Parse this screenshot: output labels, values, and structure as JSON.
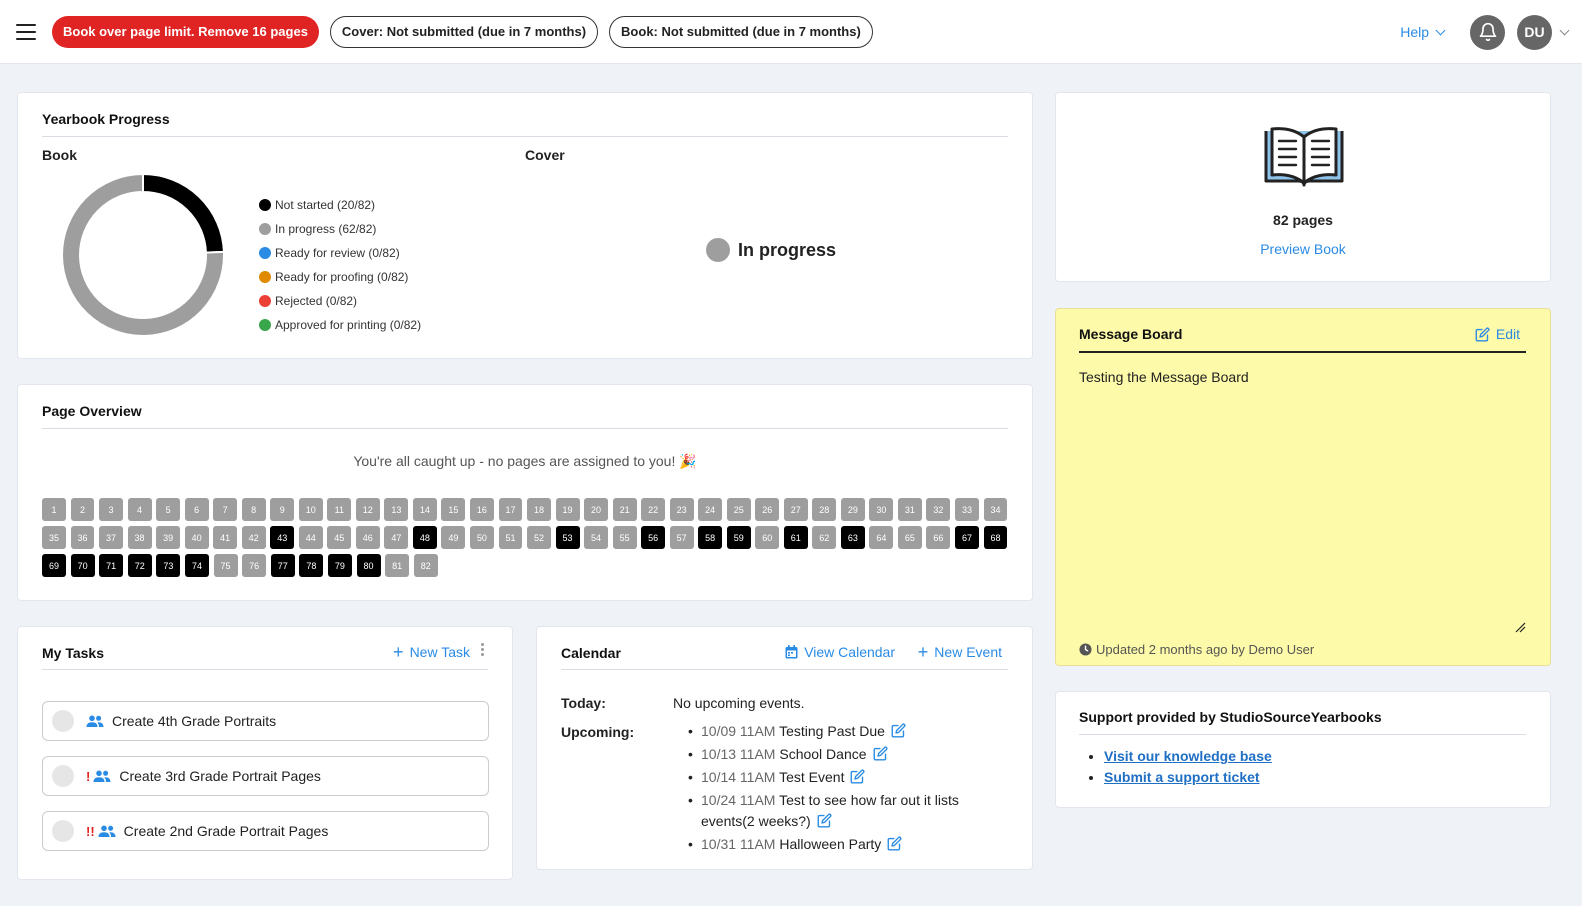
{
  "topbar": {
    "alerts": [
      {
        "label": "Book over page limit. Remove 16 pages",
        "style": "red"
      },
      {
        "label": "Cover: Not submitted (due in 7 months)",
        "style": "outline"
      },
      {
        "label": "Book: Not submitted (due in 7 months)",
        "style": "outline"
      }
    ],
    "help_label": "Help",
    "user_initials": "DU"
  },
  "progress": {
    "title": "Yearbook Progress",
    "book_label": "Book",
    "cover_label": "Cover",
    "cover_status": "In progress",
    "legend": [
      {
        "label": "Not started (20/82)",
        "color": "#000000",
        "count": 20
      },
      {
        "label": "In progress (62/82)",
        "color": "#9e9e9e",
        "count": 62
      },
      {
        "label": "Ready for review (0/82)",
        "color": "#2a8be4",
        "count": 0
      },
      {
        "label": "Ready for proofing (0/82)",
        "color": "#e08a00",
        "count": 0
      },
      {
        "label": "Rejected (0/82)",
        "color": "#ec3f36",
        "count": 0
      },
      {
        "label": "Approved for printing (0/82)",
        "color": "#3aa64b",
        "count": 0
      }
    ],
    "total": 82
  },
  "overview": {
    "title": "Page Overview",
    "message": "You're all caught up - no pages are assigned to you! 🎉",
    "total_pages": 82,
    "black_pages": [
      43,
      48,
      53,
      56,
      58,
      59,
      61,
      63,
      67,
      68,
      69,
      70,
      71,
      72,
      73,
      74,
      77,
      78,
      79,
      80
    ]
  },
  "tasks": {
    "title": "My Tasks",
    "new_label": "New Task",
    "items": [
      {
        "label": "Create 4th Grade Portraits",
        "priority": ""
      },
      {
        "label": "Create 3rd Grade Portrait Pages",
        "priority": "!"
      },
      {
        "label": "Create 2nd Grade Portrait Pages",
        "priority": "!!"
      }
    ]
  },
  "calendar": {
    "title": "Calendar",
    "view_label": "View Calendar",
    "new_label": "New Event",
    "today_label": "Today:",
    "today_value": "No upcoming events.",
    "upcoming_label": "Upcoming:",
    "events": [
      {
        "time": "10/09 11AM",
        "name": "Testing Past Due"
      },
      {
        "time": "10/13 11AM",
        "name": "School Dance"
      },
      {
        "time": "10/14 11AM",
        "name": "Test Event"
      },
      {
        "time": "10/24 11AM",
        "name": "Test to see how far out it lists events(2 weeks?)"
      },
      {
        "time": "10/31 11AM",
        "name": "Halloween Party"
      }
    ]
  },
  "book": {
    "pages_label": "82 pages",
    "preview_label": "Preview Book"
  },
  "message_board": {
    "title": "Message Board",
    "edit_label": "Edit",
    "body": "Testing the Message Board",
    "updated": "Updated 2 months ago by Demo User"
  },
  "support": {
    "title": "Support provided by StudioSourceYearbooks",
    "links": [
      "Visit our knowledge base",
      "Submit a support ticket"
    ]
  },
  "colors": {
    "accent": "#2a8be4",
    "alert_red": "#e02424",
    "note_yellow": "#fdfaa9"
  }
}
